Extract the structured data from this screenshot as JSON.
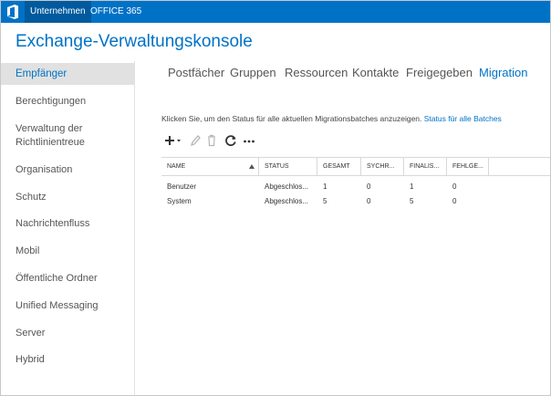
{
  "topbar": {
    "items": [
      "Unternehmen",
      "OFFICE 365"
    ]
  },
  "app": {
    "title": "Exchange-Verwaltungskonsole"
  },
  "sidebar": {
    "items": [
      {
        "label": "Empfänger",
        "selected": true
      },
      {
        "label": "Berechtigungen"
      },
      {
        "label": "Verwaltung der\nRichtlinientreue"
      },
      {
        "label": "Organisation"
      },
      {
        "label": "Schutz"
      },
      {
        "label": "Nachrichtenfluss"
      },
      {
        "label": "Mobil"
      },
      {
        "label": "Öffentliche Ordner"
      },
      {
        "label": "Unified Messaging"
      },
      {
        "label": "Server"
      },
      {
        "label": "Hybrid"
      }
    ]
  },
  "tabs": [
    {
      "label": "Postfächer"
    },
    {
      "label": "Gruppen"
    },
    {
      "label": "Ressourcen"
    },
    {
      "label": "Kontakte"
    },
    {
      "label": "Freigegeben"
    },
    {
      "label": "Migration",
      "active": true
    }
  ],
  "info": {
    "text": "Klicken Sie, um den Status für alle aktuellen Migrationsbatches anzuzeigen.",
    "link": "Status für alle Batches"
  },
  "toolbar": {
    "icons": [
      "add-icon",
      "edit-icon",
      "delete-icon",
      "refresh-icon",
      "more-icon"
    ],
    "accent": "#333333",
    "disabled": "#b5b5b5"
  },
  "table": {
    "columns": [
      "NAME",
      "STATUS",
      "GESAMT",
      "SYCHR...",
      "FINALIS...",
      "FEHLGE..."
    ],
    "rows": [
      [
        "Benutzer",
        "Abgeschlos...",
        "1",
        "0",
        "1",
        "0"
      ],
      [
        "System",
        "Abgeschlos...",
        "5",
        "0",
        "5",
        "0"
      ]
    ]
  },
  "colors": {
    "brand": "#0072c6",
    "selected_nav_bg": "#e1e1e1"
  }
}
